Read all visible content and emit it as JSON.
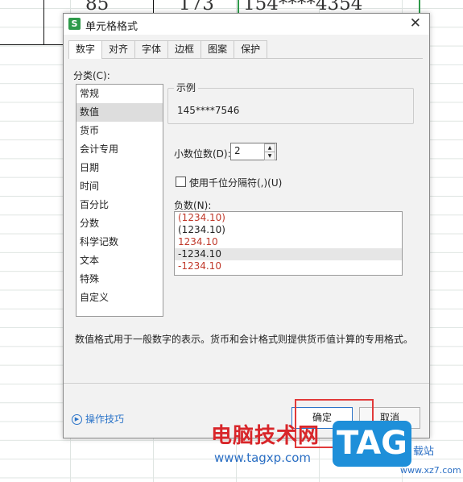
{
  "sheet": {
    "cells": [
      "85",
      "173",
      "154****4354"
    ]
  },
  "dialog": {
    "app_icon": "S",
    "title": "单元格格式",
    "close": "✕",
    "tabs": [
      "数字",
      "对齐",
      "字体",
      "边框",
      "图案",
      "保护"
    ],
    "category_label": "分类(C):",
    "categories": [
      "常规",
      "数值",
      "货币",
      "会计专用",
      "日期",
      "时间",
      "百分比",
      "分数",
      "科学记数",
      "文本",
      "特殊",
      "自定义"
    ],
    "sample_label": "示例",
    "sample_value": "145****7546",
    "decimal_label": "小数位数(D):",
    "decimal_value": "2",
    "thousands_label": "使用千位分隔符(,)(U)",
    "negative_label": "负数(N):",
    "negatives": [
      "(1234.10)",
      "(1234.10)",
      "1234.10",
      "-1234.10",
      "-1234.10"
    ],
    "negative_colors": [
      "#c0392b",
      "#222222",
      "#c0392b",
      "#222222",
      "#c0392b"
    ],
    "description": "数值格式用于一般数字的表示。货币和会计格式则提供货币值计算的专用格式。",
    "tips_label": "操作技巧",
    "ok_label": "确定",
    "cancel_label": "取消"
  },
  "watermark": {
    "title": "电脑技术网",
    "url": "www.tagxp.com",
    "tag": "TAG",
    "side": "载站",
    "side2": "www.xz7.com"
  }
}
